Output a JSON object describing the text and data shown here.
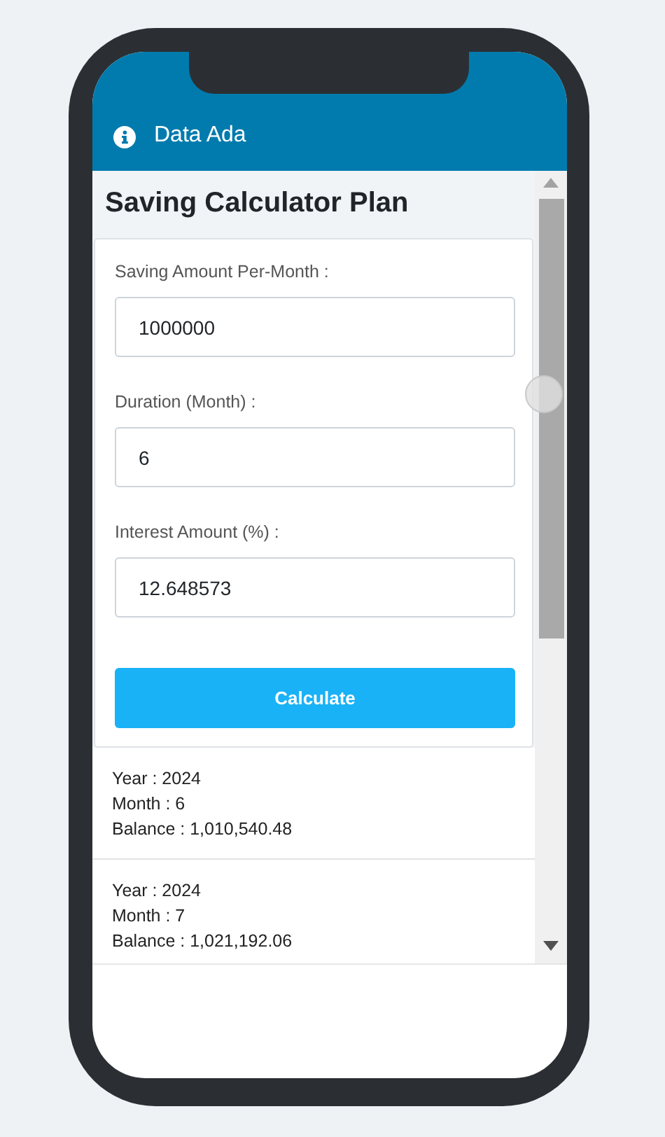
{
  "header": {
    "title": "Data Ada"
  },
  "page_title": "Saving Calculator Plan",
  "fields": [
    {
      "label": "Saving Amount Per-Month :",
      "value": "1000000"
    },
    {
      "label": "Duration (Month) :",
      "value": "6"
    },
    {
      "label": "Interest Amount (%) :",
      "value": "12.648573"
    }
  ],
  "button": "Calculate",
  "results": [
    {
      "lines": [
        "Year : 2024",
        "Month : 6",
        "Balance : 1,010,540.48"
      ]
    },
    {
      "lines": [
        "Year : 2024",
        "Month : 7",
        "Balance : 1,021,192.06"
      ]
    }
  ]
}
